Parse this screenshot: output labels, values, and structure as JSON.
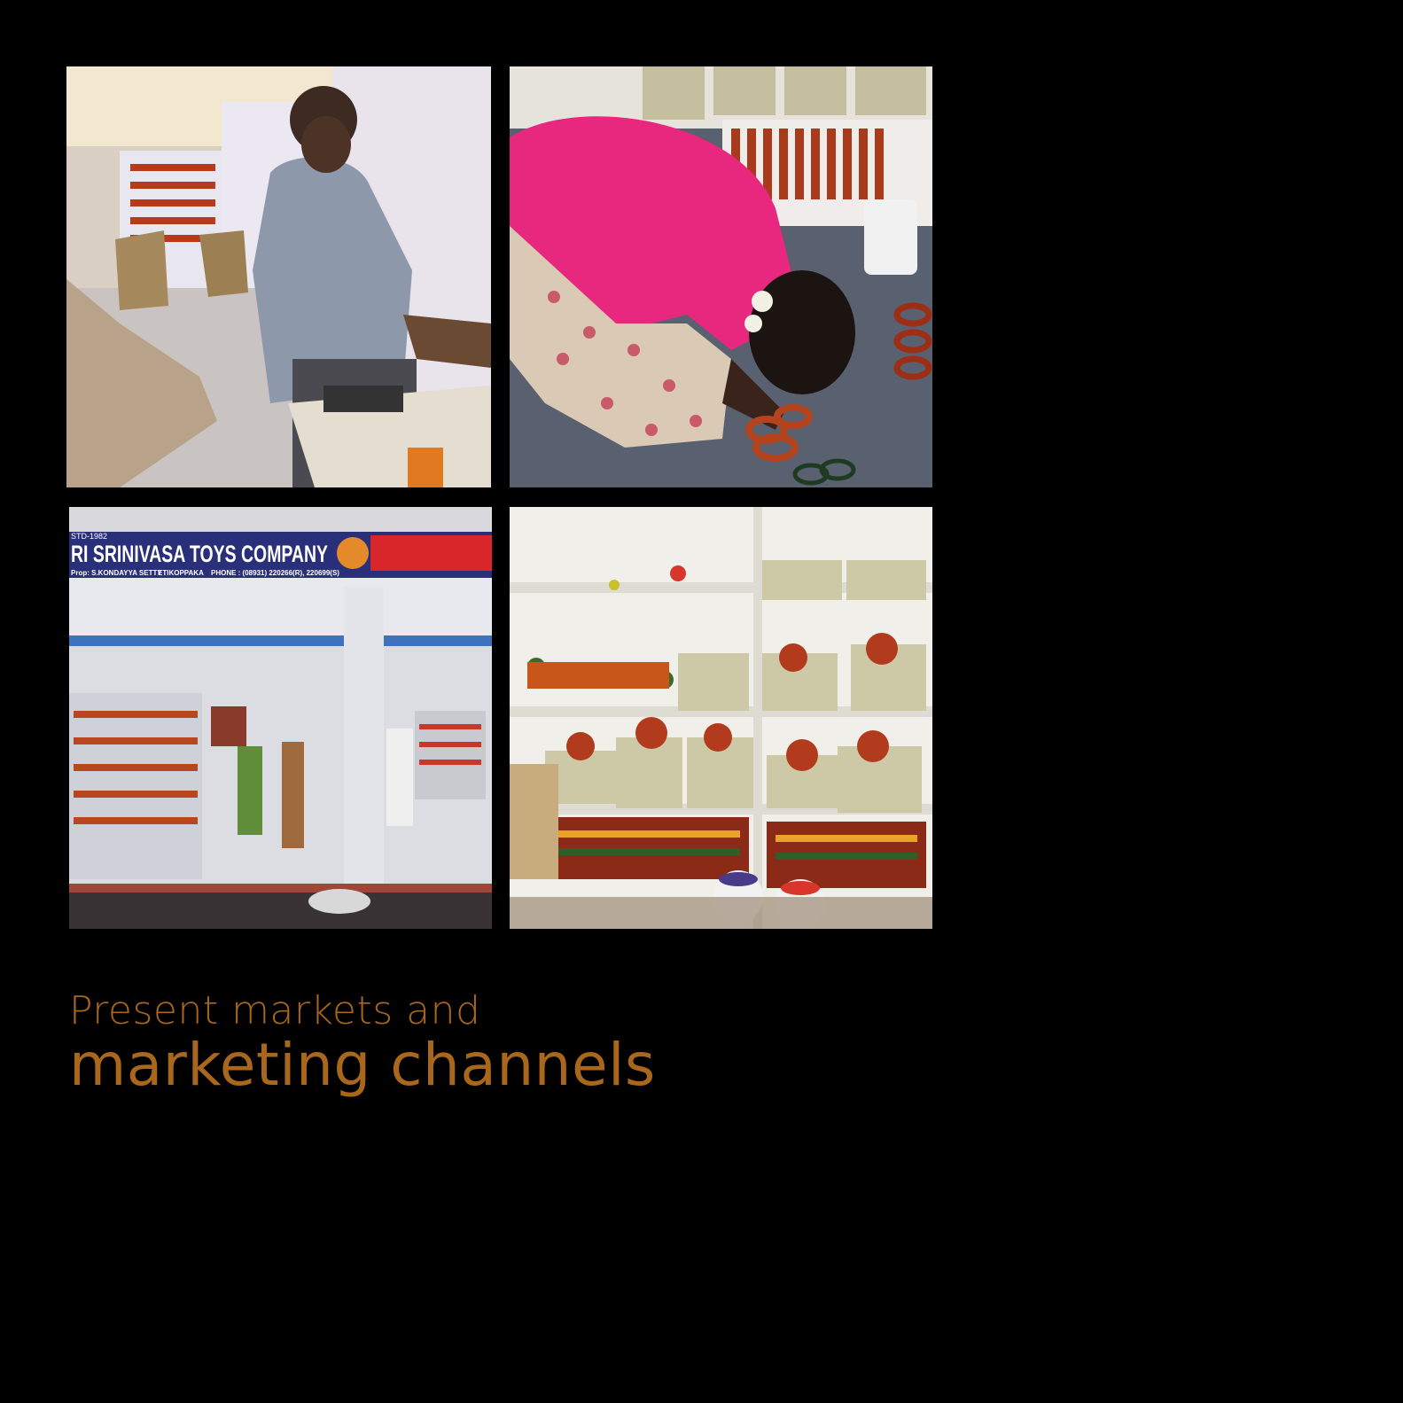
{
  "caption": {
    "line1": "Present markets  and",
    "line2": "marketing channels"
  },
  "photos": {
    "shop_sign": {
      "est": "STD-1982",
      "name": "RI SRINIVASA TOYS COMPANY",
      "proprietor": "Prop: S.KONDAYYA SETTY",
      "place": "ETIKOPPAKA",
      "phone": "PHONE : (08931) 220266(R), 220699(S)"
    }
  },
  "colors": {
    "background": "#000000",
    "caption": "#a8671b",
    "sign_bg": "#2a2f7a",
    "sign_text": "#ffffff",
    "sign_red": "#d8262a"
  }
}
